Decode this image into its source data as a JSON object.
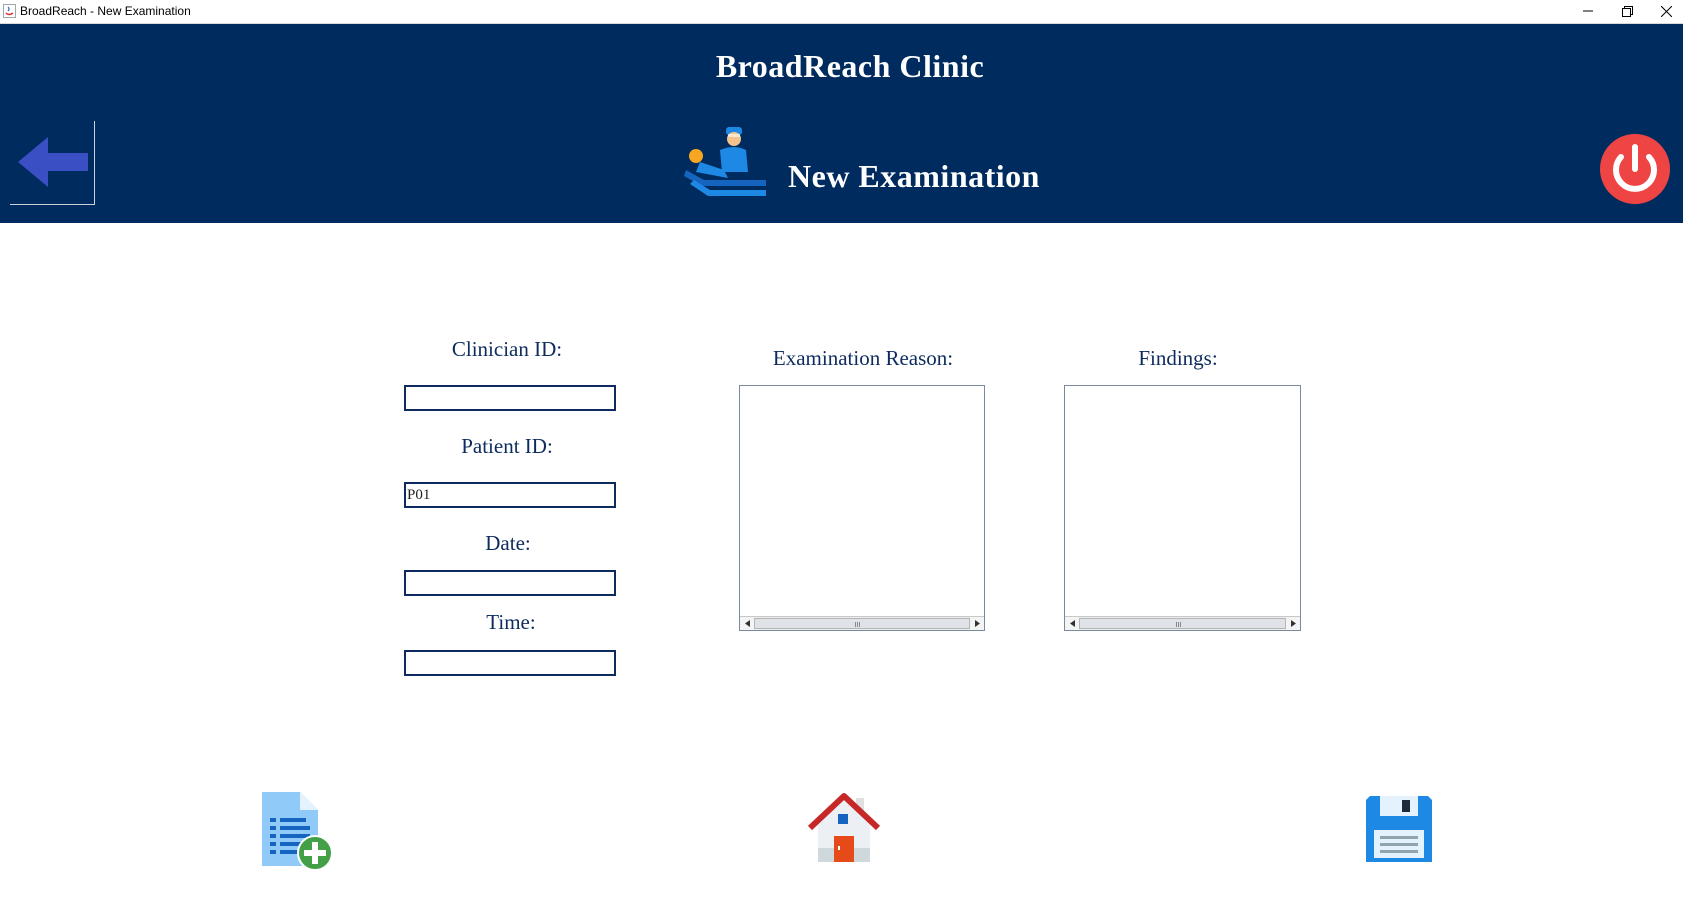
{
  "window": {
    "title": "BroadReach - New Examination",
    "icons": [
      "java-app-icon",
      "minimize-icon",
      "restore-icon",
      "close-icon"
    ]
  },
  "header": {
    "clinic_name": "BroadReach Clinic",
    "page_title": "New Examination",
    "icons": [
      "back-arrow-icon",
      "examination-patient-icon",
      "power-icon"
    ],
    "colors": {
      "header_bg": "#002b5e",
      "power_red": "#ef4444",
      "back_arrow": "#3b4fc4"
    }
  },
  "form": {
    "clinician_id_label": "Clinician ID:",
    "clinician_id_value": "",
    "patient_id_label": "Patient ID:",
    "patient_id_value": "P01",
    "date_label": "Date:",
    "date_value": "",
    "time_label": "Time:",
    "time_value": "",
    "exam_reason_label": "Examination Reason:",
    "exam_reason_value": "",
    "findings_label": "Findings:",
    "findings_value": ""
  },
  "footer": {
    "icons": [
      "new-document-icon",
      "home-icon",
      "save-icon"
    ]
  }
}
